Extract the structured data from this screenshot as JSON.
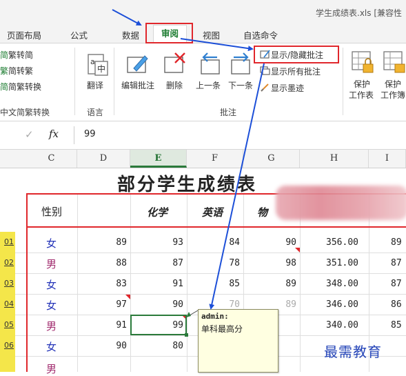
{
  "window": {
    "title": "学生成绩表.xls  [兼容性"
  },
  "tabs": [
    {
      "label": "页面布局"
    },
    {
      "label": "公式"
    },
    {
      "label": "数据"
    },
    {
      "label": "审阅"
    },
    {
      "label": "视图"
    },
    {
      "label": "自选命令"
    }
  ],
  "ribbon": {
    "chinese_group": {
      "items": [
        "繁转简",
        "简转繁",
        "简繁转换"
      ],
      "group_label": "中文简繁转换"
    },
    "language_group": {
      "translate_label": "翻译",
      "group_label": "语言"
    },
    "comments_group": {
      "edit_label": "编辑批注",
      "delete_label": "删除",
      "prev_label": "上一条",
      "next_label": "下一条",
      "show_hide_label": "显示/隐藏批注",
      "show_all_label": "显示所有批注",
      "show_ink_label": "显示墨迹",
      "group_label": "批注"
    },
    "protect_group": {
      "protect_sheet_label": "保护工作表",
      "protect_book_label": "保护工作簿"
    }
  },
  "formula_bar": {
    "cancel_glyph": "✓",
    "fx": "fx",
    "value": "99"
  },
  "columns": [
    "C",
    "D",
    "E",
    "F",
    "G",
    "H",
    "I"
  ],
  "sheet": {
    "title": "部分学生成绩表",
    "headers": [
      "性别",
      "",
      "化学",
      "英语",
      "物"
    ],
    "rows": [
      {
        "id": "01",
        "gender": "女",
        "d": "89",
        "e": "93",
        "f": "84",
        "g": "90",
        "h": "356.00",
        "i": "89"
      },
      {
        "id": "02",
        "gender": "男",
        "d": "88",
        "e": "87",
        "f": "78",
        "g": "98",
        "h": "351.00",
        "i": "87"
      },
      {
        "id": "03",
        "gender": "女",
        "d": "83",
        "e": "91",
        "f": "85",
        "g": "89",
        "h": "348.00",
        "i": "87"
      },
      {
        "id": "04",
        "gender": "女",
        "d": "97",
        "e": "90",
        "f": "70",
        "g": "89",
        "h": "346.00",
        "i": "86"
      },
      {
        "id": "05",
        "gender": "男",
        "d": "91",
        "e": "99",
        "f": "",
        "g": "",
        "h": "340.00",
        "i": "85"
      },
      {
        "id": "06",
        "gender": "女",
        "d": "90",
        "e": "80",
        "f": "",
        "g": "",
        "h": "",
        "i": ""
      }
    ],
    "partial_row_gender": "男"
  },
  "comment": {
    "author": "admin:",
    "text": "单科最高分"
  },
  "watermark": "最需教育",
  "colors": {
    "accent_green": "#1e7d32",
    "highlight_red": "#e0262b",
    "arrow_blue": "#1c4fd8",
    "female": "#2232b8",
    "male": "#a12b6e",
    "comment_bg": "#ffffe1"
  }
}
